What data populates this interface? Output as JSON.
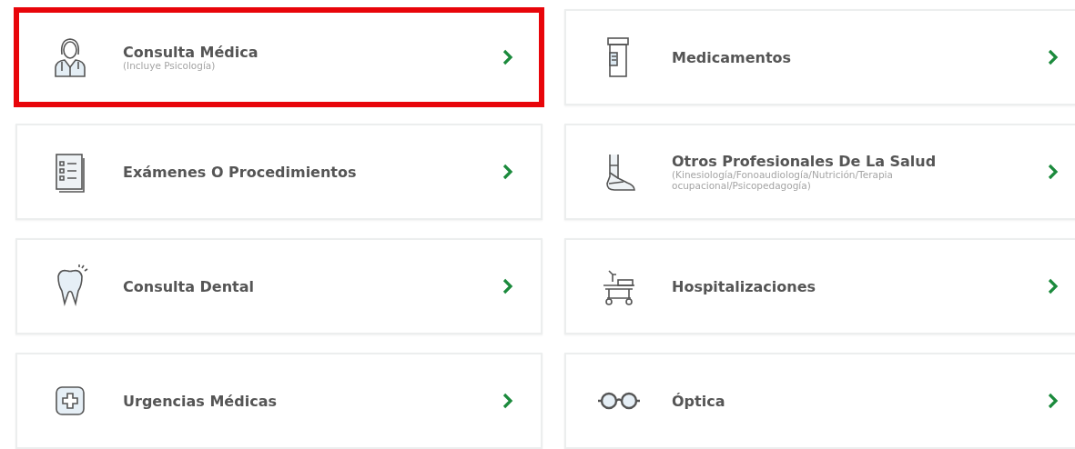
{
  "rows": [
    {
      "cards": [
        {
          "kind": "doctor",
          "title": "Consulta Médica",
          "subtitle": "(Incluye Psicología)",
          "highlighted": true
        },
        {
          "kind": "medicine",
          "title": "Medicamentos",
          "highlighted": false
        }
      ]
    },
    {
      "cards": [
        {
          "kind": "exams",
          "title": "Exámenes O Procedimientos",
          "highlighted": false
        },
        {
          "kind": "therapy",
          "title": "Otros Profesionales De La Salud",
          "subtitle": "(Kinesiología/Fonoaudiología/Nutrición/Terapia ocupacional/Psicopedagogía)",
          "highlighted": false
        }
      ]
    },
    {
      "cards": [
        {
          "kind": "dental",
          "title": "Consulta Dental",
          "highlighted": false
        },
        {
          "kind": "hospital",
          "title": "Hospitalizaciones",
          "highlighted": false
        }
      ]
    },
    {
      "cards": [
        {
          "kind": "emergency",
          "title": "Urgencias Médicas",
          "highlighted": false
        },
        {
          "kind": "optics",
          "title": "Óptica",
          "highlighted": false
        }
      ]
    }
  ]
}
